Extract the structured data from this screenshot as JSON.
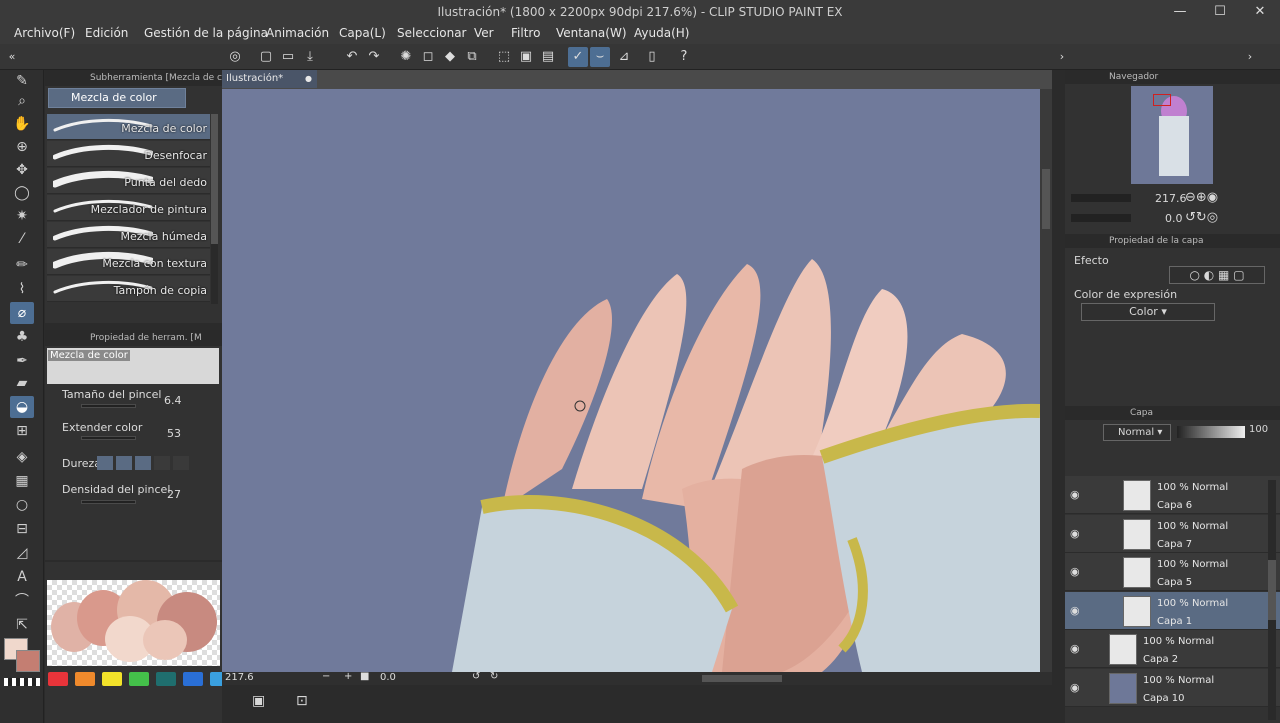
{
  "window": {
    "title": "Ilustración* (1800 x 2200px 90dpi 217.6%)  - CLIP STUDIO PAINT EX",
    "minimize": "—",
    "maximize": "☐",
    "close": "✕"
  },
  "menu": [
    "Archivo(F)",
    "Edición",
    "Gestión de la página",
    "Animación",
    "Capa(L)",
    "Seleccionar",
    "Ver",
    "Filtro",
    "Ventana(W)",
    "Ayuda(H)"
  ],
  "subtool": {
    "header": "Subherramienta [Mezcla de colo",
    "group": "Mezcla de color",
    "brushes": [
      "Mezcla de color",
      "Desenfocar",
      "Punta del dedo",
      "Mezclador de pintura",
      "Mezcla húmeda",
      "Mezcla con textura",
      "Tampón de copia"
    ]
  },
  "tool_property": {
    "header": "Propiedad de herram. [M",
    "preview_label": "Mezcla de color",
    "brush_size_label": "Tamaño del pincel",
    "brush_size": "6.4",
    "spread_label": "Extender color",
    "spread": "53",
    "hardness_label": "Dureza",
    "density_label": "Densidad del pincel",
    "density": "27"
  },
  "canvas": {
    "tab": "Ilustración*",
    "zoom": "217.6",
    "angle": "0.0"
  },
  "navigator": {
    "header": "Navegador",
    "zoom": "217.6",
    "rotation": "0.0"
  },
  "layer_property": {
    "header": "Propiedad de la capa",
    "effect_label": "Efecto",
    "expression_label": "Color de expresión",
    "expression_value": "Color"
  },
  "layers_panel": {
    "header": "Capa",
    "blend_mode": "Normal",
    "opacity": "100",
    "layers": [
      {
        "mode": "100 % Normal",
        "name": "Capa 6"
      },
      {
        "mode": "100 % Normal",
        "name": "Capa 7"
      },
      {
        "mode": "100 % Normal",
        "name": "Capa 5"
      },
      {
        "mode": "100 % Normal",
        "name": "Capa 1"
      },
      {
        "mode": "100 % Normal",
        "name": "Capa 2"
      },
      {
        "mode": "100 % Normal",
        "name": "Capa 10"
      }
    ]
  },
  "colors": {
    "main": "#f0d8cc",
    "sub": "#c47e72",
    "accent": "#4d6e93",
    "palette": [
      "#e8343a",
      "#f08a2c",
      "#f2e22a",
      "#44c04a",
      "#1f6e6e",
      "#2a6fd6",
      "#3aa0e0"
    ]
  },
  "icons": [
    "pen-icon",
    "zoom-icon",
    "hand-icon",
    "move-icon",
    "lasso-icon",
    "wand-icon",
    "eyedropper-icon",
    "pencil-icon",
    "brush-icon",
    "blend-icon",
    "eraser-icon",
    "fill-icon",
    "text-icon",
    "eye-icon"
  ]
}
